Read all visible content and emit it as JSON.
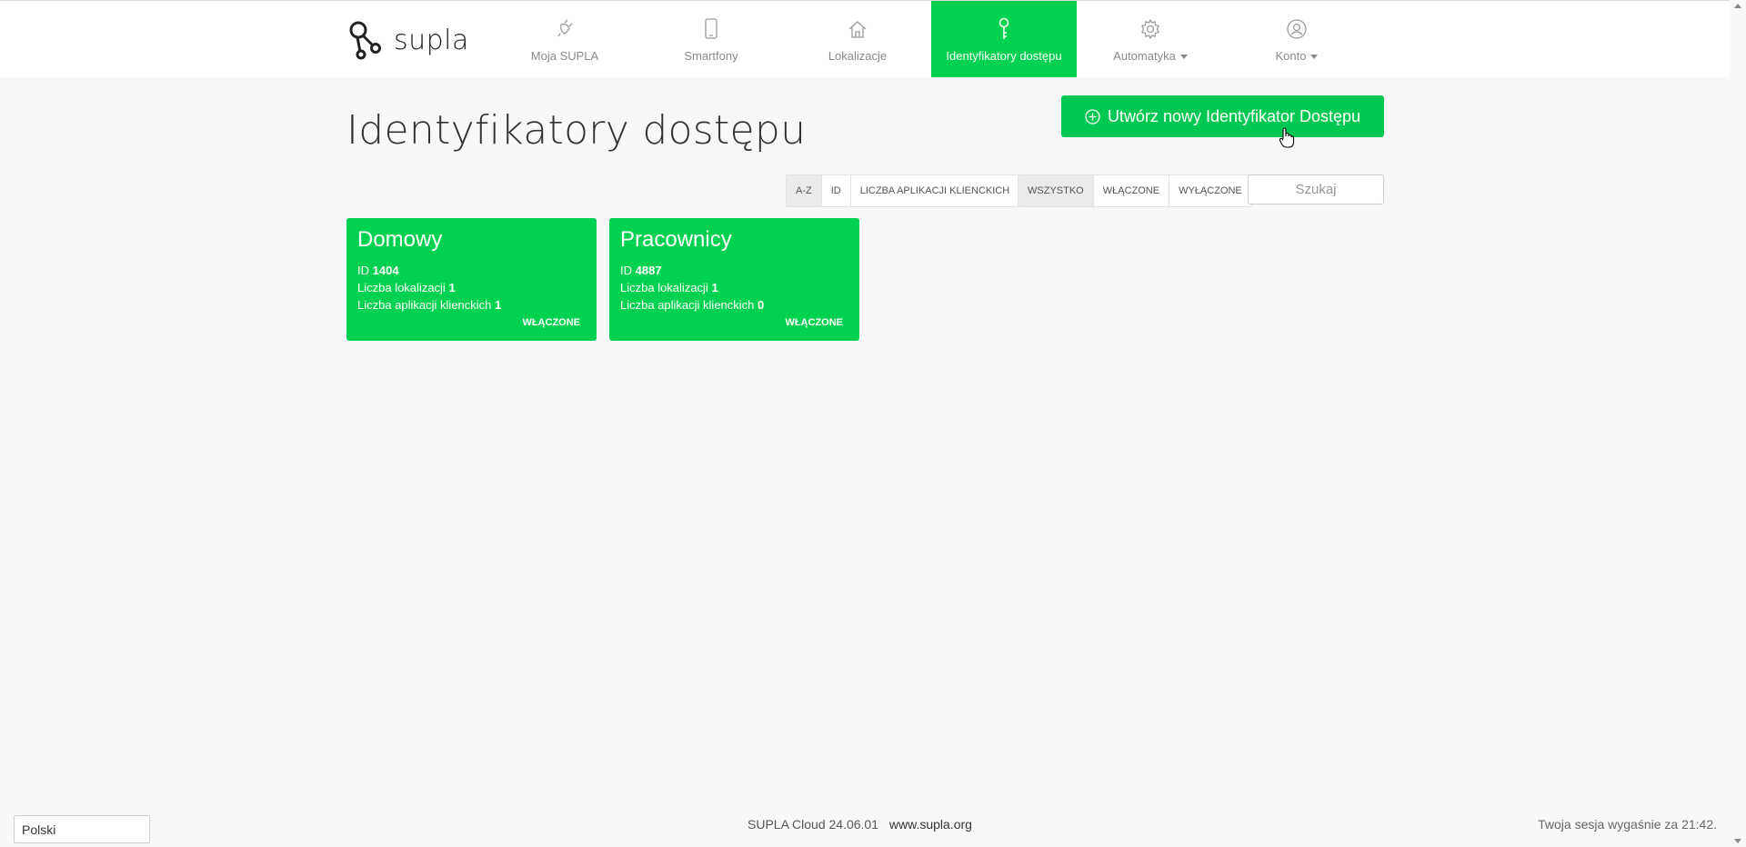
{
  "brand": {
    "name": "supla"
  },
  "nav": {
    "items": [
      {
        "label": "Moja SUPLA",
        "icon": "plug-icon"
      },
      {
        "label": "Smartfony",
        "icon": "smartphone-icon"
      },
      {
        "label": "Lokalizacje",
        "icon": "home-icon"
      },
      {
        "label": "Identyfikatory dostępu",
        "icon": "key-icon"
      },
      {
        "label": "Automatyka",
        "icon": "gear-icon"
      },
      {
        "label": "Konto",
        "icon": "user-icon"
      }
    ],
    "active": "Identyfikatory dostępu"
  },
  "page": {
    "title": "Identyfikatory dostępu",
    "create_button": "Utwórz nowy Identyfikator Dostępu"
  },
  "sort": {
    "options": [
      "A-Z",
      "ID",
      "LICZBA APLIKACJI KLIENCKICH"
    ],
    "selected": "A-Z"
  },
  "filter": {
    "options": [
      "WSZYSTKO",
      "WŁĄCZONE",
      "WYŁĄCZONE"
    ],
    "selected": "WSZYSTKO"
  },
  "search": {
    "placeholder": "Szukaj",
    "value": ""
  },
  "cards": [
    {
      "name": "Domowy",
      "id_label": "ID",
      "id": "1404",
      "locations_label": "Liczba lokalizacji",
      "locations": "1",
      "clients_label": "Liczba aplikacji klienckich",
      "clients": "1",
      "status": "WŁĄCZONE"
    },
    {
      "name": "Pracownicy",
      "id_label": "ID",
      "id": "4887",
      "locations_label": "Liczba lokalizacji",
      "locations": "1",
      "clients_label": "Liczba aplikacji klienckich",
      "clients": "0",
      "status": "WŁĄCZONE"
    }
  ],
  "footer": {
    "language": "Polski",
    "version": "SUPLA Cloud 24.06.01",
    "link": "www.supla.org",
    "session": "Twoja sesja wygaśnie za 21:42."
  },
  "colors": {
    "accent": "#00d151",
    "button": "#00c853",
    "background": "#f7f8fa"
  }
}
